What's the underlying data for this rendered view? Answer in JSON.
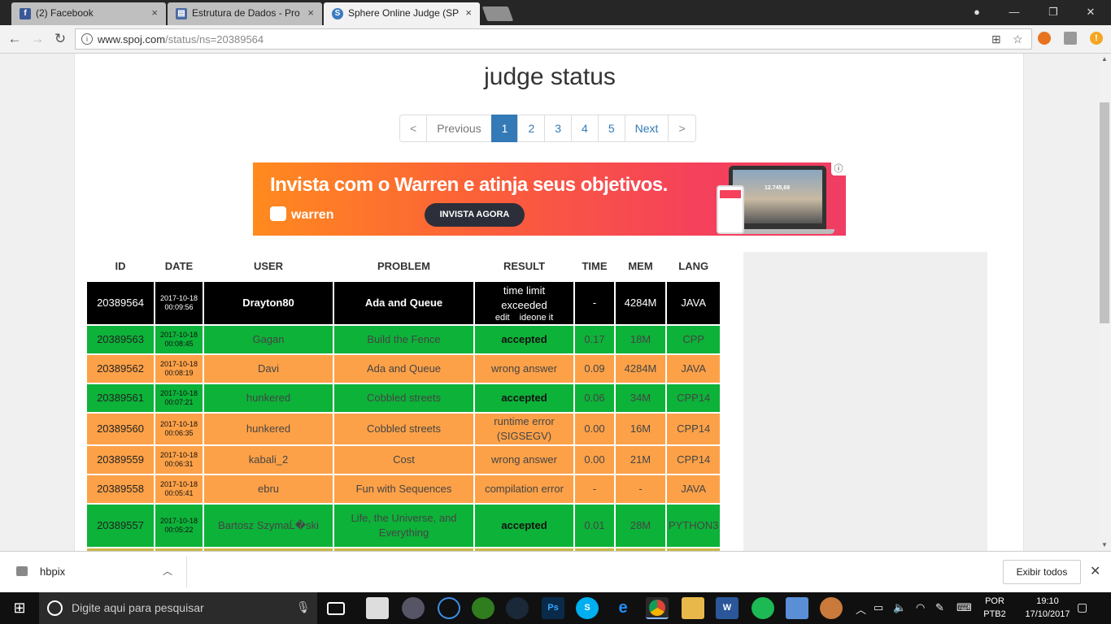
{
  "browser": {
    "tabs": [
      {
        "title": "(2) Facebook",
        "icon": "facebook-icon",
        "color": "#3b5998",
        "glyph": "f"
      },
      {
        "title": "Estrutura de Dados - Pro",
        "icon": "document-icon",
        "color": "#4a6aa5",
        "glyph": "▤"
      },
      {
        "title": "Sphere Online Judge (SP",
        "icon": "spoj-icon",
        "color": "#3b7bbf",
        "glyph": "S"
      }
    ],
    "url_host": "www.spoj.com",
    "url_path": "/status/ns=20389564",
    "nav": {
      "back": "←",
      "forward": "→",
      "reload": "↻",
      "close_tab": "×",
      "minimize": "—",
      "restore": "❐",
      "close_window": "✕",
      "translate": "⊞",
      "star": "☆",
      "profile": "●"
    }
  },
  "page": {
    "title": "judge status",
    "pagination": [
      "<",
      "Previous",
      "1",
      "2",
      "3",
      "4",
      "5",
      "Next",
      ">"
    ],
    "active_page": "1"
  },
  "ad": {
    "headline": "Invista com o Warren e atinja seus objetivos.",
    "logo": "warren",
    "cta": "INVISTA AGORA",
    "screen_value": "12.745,69",
    "info": "ⓘ"
  },
  "table": {
    "headers": [
      "ID",
      "DATE",
      "USER",
      "PROBLEM",
      "RESULT",
      "TIME",
      "MEM",
      "LANG"
    ],
    "rows": [
      {
        "id": "20389564",
        "date": "2017-10-18",
        "time_of_day": "00:09:56",
        "user": "Drayton80",
        "problem": "Ada and Queue",
        "result": "time limit exceeded",
        "result_links": [
          "edit",
          "ideone it"
        ],
        "time": "-",
        "mem": "4284M",
        "lang": "JAVA",
        "status": "black"
      },
      {
        "id": "20389563",
        "date": "2017-10-18",
        "time_of_day": "00:08:45",
        "user": "Gagan",
        "problem": "Build the Fence",
        "result": "accepted",
        "time": "0.17",
        "mem": "18M",
        "lang": "CPP",
        "status": "green"
      },
      {
        "id": "20389562",
        "date": "2017-10-18",
        "time_of_day": "00:08:19",
        "user": "Davi",
        "problem": "Ada and Queue",
        "result": "wrong answer",
        "time": "0.09",
        "mem": "4284M",
        "lang": "JAVA",
        "status": "orange"
      },
      {
        "id": "20389561",
        "date": "2017-10-18",
        "time_of_day": "00:07:21",
        "user": "hunkered",
        "problem": "Cobbled streets",
        "result": "accepted",
        "time": "0.06",
        "mem": "34M",
        "lang": "CPP14",
        "status": "green"
      },
      {
        "id": "20389560",
        "date": "2017-10-18",
        "time_of_day": "00:06:35",
        "user": "hunkered",
        "problem": "Cobbled streets",
        "result": "runtime error (SIGSEGV)",
        "time": "0.00",
        "mem": "16M",
        "lang": "CPP14",
        "status": "orange"
      },
      {
        "id": "20389559",
        "date": "2017-10-18",
        "time_of_day": "00:06:31",
        "user": "kabali_2",
        "problem": "Cost",
        "result": "wrong answer",
        "time": "0.00",
        "mem": "21M",
        "lang": "CPP14",
        "status": "orange"
      },
      {
        "id": "20389558",
        "date": "2017-10-18",
        "time_of_day": "00:05:41",
        "user": "ebru",
        "problem": "Fun with Sequences",
        "result": "compilation error",
        "time": "-",
        "mem": "-",
        "lang": "JAVA",
        "status": "orange"
      },
      {
        "id": "20389557",
        "date": "2017-10-18",
        "time_of_day": "00:05:22",
        "user": "Bartosz SzymaĹ�ski",
        "problem": "Life, the Universe, and Everything",
        "result": "accepted",
        "time": "0.01",
        "mem": "28M",
        "lang": "PYTHON3",
        "status": "green"
      }
    ]
  },
  "download_shelf": {
    "file": "hbpix",
    "show_all": "Exibir todos",
    "close": "✕",
    "chevron": "︿"
  },
  "taskbar": {
    "search_placeholder": "Digite aqui para pesquisar",
    "language_1": "POR",
    "language_2": "PTB2",
    "time": "19:10",
    "date": "17/10/2017"
  },
  "colors": {
    "accepted": "#0db239",
    "error": "#fda148",
    "pending": "#000000",
    "link": "#337ab7"
  }
}
